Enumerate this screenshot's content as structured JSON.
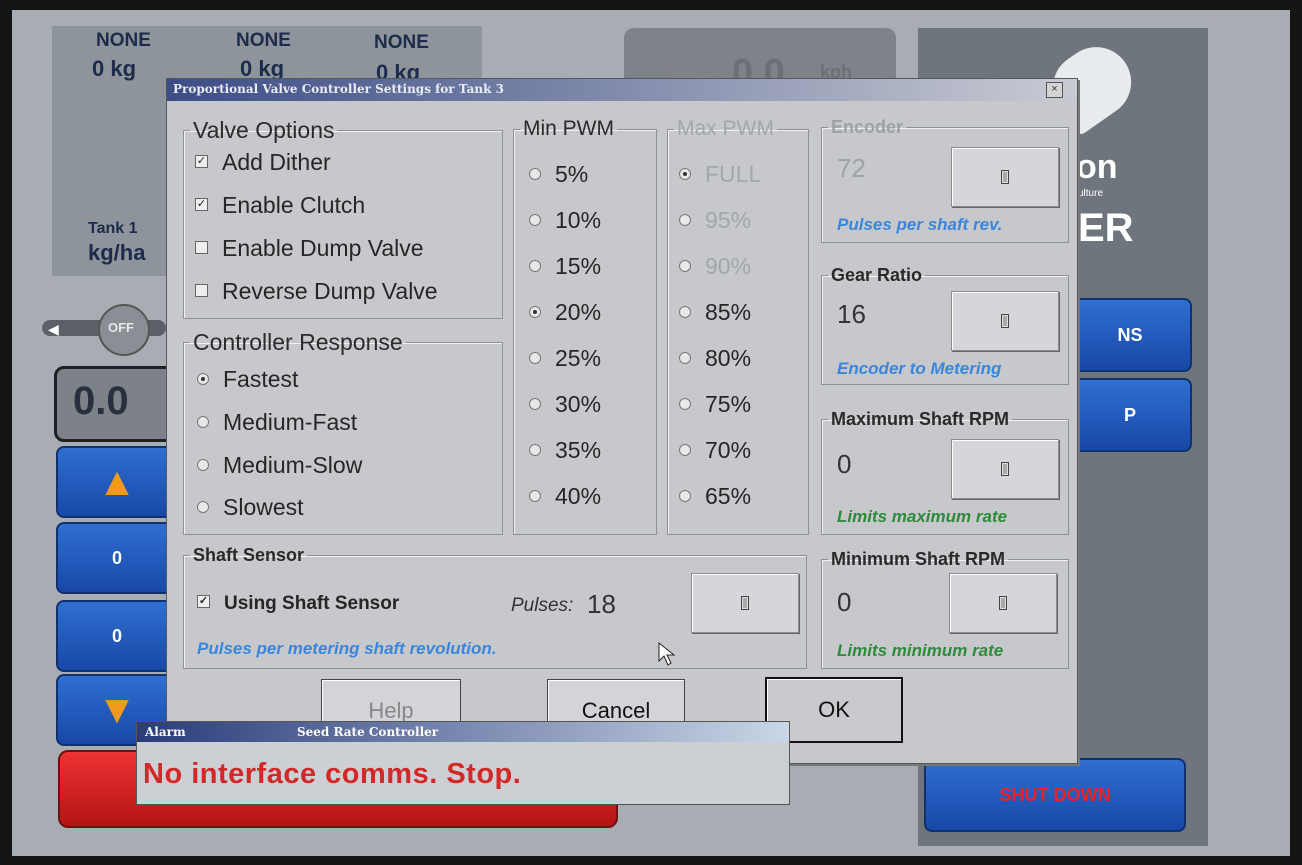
{
  "background": {
    "tanks": [
      {
        "name": "NONE",
        "value": "0 kg"
      },
      {
        "name": "NONE",
        "value": "0 kg"
      },
      {
        "name": "NONE",
        "value": "0 kg"
      }
    ],
    "speed": {
      "value": "0.0",
      "unit": "kph"
    },
    "tank1_label": "Tank 1",
    "tank1_unit": "kg/ha",
    "toggle_label": "OFF",
    "rate_display": "0.0",
    "counter1": "0",
    "counter2": "0",
    "brand_text": "on",
    "brand_small": "ulture",
    "brand_big": "ER",
    "side_button1": "NS",
    "side_button2": "P",
    "shutdown_label": "SHUT DOWN"
  },
  "dialog": {
    "title": "Proportional Valve Controller Settings for Tank 3",
    "close_glyph": "×",
    "valve_options": {
      "legend": "Valve Options",
      "items": [
        {
          "label": "Add Dither",
          "checked": true
        },
        {
          "label": "Enable Clutch",
          "checked": true
        },
        {
          "label": "Enable Dump Valve",
          "checked": false
        },
        {
          "label": "Reverse Dump Valve",
          "checked": false
        }
      ]
    },
    "controller_response": {
      "legend": "Controller Response",
      "items": [
        {
          "label": "Fastest",
          "selected": true
        },
        {
          "label": "Medium-Fast",
          "selected": false
        },
        {
          "label": "Medium-Slow",
          "selected": false
        },
        {
          "label": "Slowest",
          "selected": false
        }
      ]
    },
    "min_pwm": {
      "legend": "Min PWM",
      "items": [
        {
          "label": "5%",
          "selected": false
        },
        {
          "label": "10%",
          "selected": false
        },
        {
          "label": "15%",
          "selected": false
        },
        {
          "label": "20%",
          "selected": true
        },
        {
          "label": "25%",
          "selected": false
        },
        {
          "label": "30%",
          "selected": false
        },
        {
          "label": "35%",
          "selected": false
        },
        {
          "label": "40%",
          "selected": false
        }
      ]
    },
    "max_pwm": {
      "legend": "Max PWM",
      "items": [
        {
          "label": "FULL",
          "selected": true
        },
        {
          "label": "95%",
          "selected": false
        },
        {
          "label": "90%",
          "selected": false
        },
        {
          "label": "85%",
          "selected": false
        },
        {
          "label": "80%",
          "selected": false
        },
        {
          "label": "75%",
          "selected": false
        },
        {
          "label": "70%",
          "selected": false
        },
        {
          "label": "65%",
          "selected": false
        }
      ]
    },
    "encoder": {
      "legend": "Encoder",
      "value": "72",
      "hint": "Pulses per shaft rev."
    },
    "gear_ratio": {
      "legend": "Gear Ratio",
      "value": "16",
      "hint": "Encoder to Metering"
    },
    "max_shaft_rpm": {
      "legend": "Maximum Shaft RPM",
      "value": "0",
      "hint": "Limits maximum rate"
    },
    "min_shaft_rpm": {
      "legend": "Minimum Shaft RPM",
      "value": "0",
      "hint": "Limits minimum rate"
    },
    "shaft_sensor": {
      "legend": "Shaft Sensor",
      "checkbox_label": "Using Shaft Sensor",
      "checked": true,
      "pulses_label": "Pulses:",
      "pulses_value": "18",
      "hint": "Pulses per metering shaft revolution."
    },
    "buttons": {
      "help": "Help",
      "cancel": "Cancel",
      "ok": "OK"
    }
  },
  "alarm": {
    "title": "Alarm",
    "source": "Seed Rate Controller",
    "message": "No interface comms. Stop."
  }
}
